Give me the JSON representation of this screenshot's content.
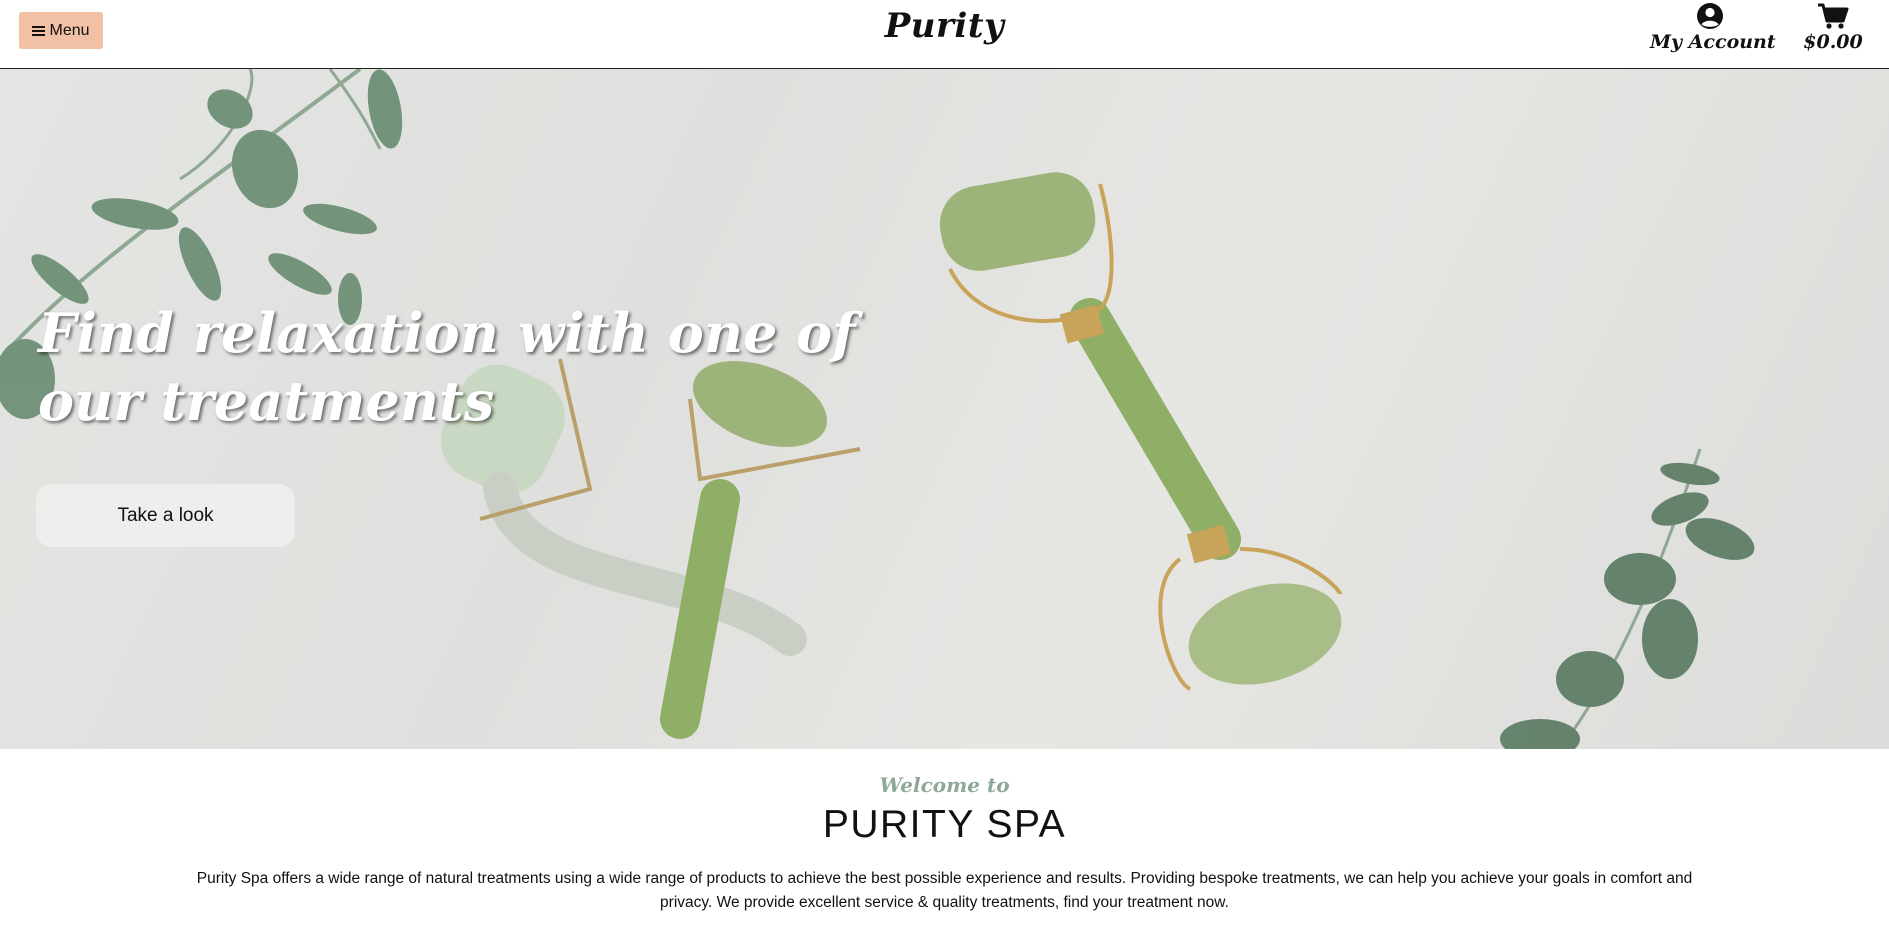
{
  "header": {
    "menu_label": "Menu",
    "brand": "Purity",
    "account_label": "My Account",
    "cart_total": "$0.00",
    "icons": {
      "menu": "hamburger-icon",
      "account": "user-circle-icon",
      "cart": "shopping-cart-icon"
    },
    "accent_color": "#f2c0a4"
  },
  "hero": {
    "title": "Find relaxation with one of our treatments",
    "cta_label": "Take a look"
  },
  "welcome": {
    "subtitle": "Welcome to",
    "title": "PURITY SPA",
    "body": "Purity Spa offers a wide range of natural treatments using a wide range of products to achieve the best possible experience and results. Providing bespoke treatments, we can help you achieve your goals in comfort and privacy. We provide excellent service & quality treatments, find your treatment now.",
    "subtitle_color": "#8ea898"
  }
}
